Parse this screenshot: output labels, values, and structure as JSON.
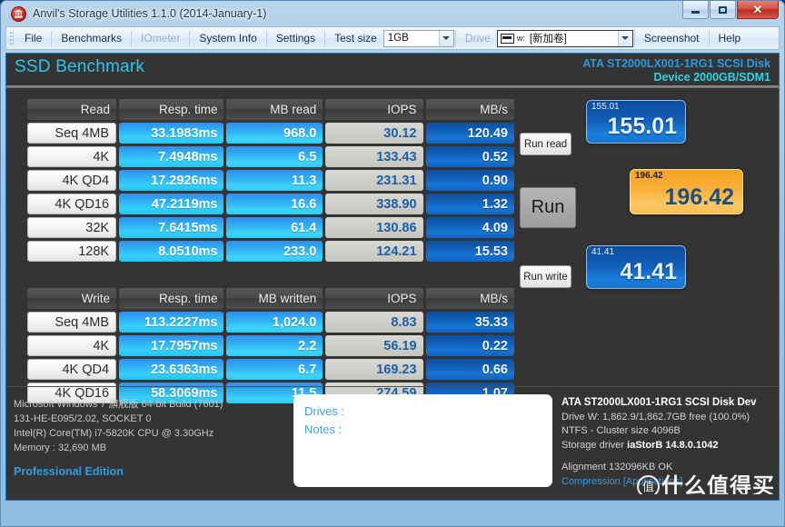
{
  "window": {
    "title": "Anvil's Storage Utilities 1.1.0 (2014-January-1)",
    "minimize_label": "Minimize",
    "maximize_label": "Maximize",
    "close_label": "Close"
  },
  "toolbar": {
    "file": "File",
    "benchmarks": "Benchmarks",
    "iometer": "IOmeter",
    "system_info": "System Info",
    "settings": "Settings",
    "test_size_label": "Test size",
    "test_size_value": "1GB",
    "drive_label": "Drive",
    "drive_prefix": "w:",
    "drive_value": "[新加卷]",
    "screenshot": "Screenshot",
    "help": "Help"
  },
  "header": {
    "section_title": "SSD Benchmark",
    "device_line1": "ATA ST2000LX001-1RG1 SCSI Disk",
    "device_line2": "Device 2000GB/SDM1"
  },
  "read_table": {
    "headers": [
      "Read",
      "Resp. time",
      "MB read",
      "IOPS",
      "MB/s"
    ],
    "rows": [
      {
        "label": "Seq 4MB",
        "resp": "33.1983ms",
        "mb": "968.0",
        "iops": "30.12",
        "mbs": "120.49"
      },
      {
        "label": "4K",
        "resp": "7.4948ms",
        "mb": "6.5",
        "iops": "133.43",
        "mbs": "0.52"
      },
      {
        "label": "4K QD4",
        "resp": "17.2926ms",
        "mb": "11.3",
        "iops": "231.31",
        "mbs": "0.90"
      },
      {
        "label": "4K QD16",
        "resp": "47.2119ms",
        "mb": "16.6",
        "iops": "338.90",
        "mbs": "1.32"
      },
      {
        "label": "32K",
        "resp": "7.6415ms",
        "mb": "61.4",
        "iops": "130.86",
        "mbs": "4.09"
      },
      {
        "label": "128K",
        "resp": "8.0510ms",
        "mb": "233.0",
        "iops": "124.21",
        "mbs": "15.53"
      }
    ]
  },
  "write_table": {
    "headers": [
      "Write",
      "Resp. time",
      "MB written",
      "IOPS",
      "MB/s"
    ],
    "rows": [
      {
        "label": "Seq 4MB",
        "resp": "113.2227ms",
        "mb": "1,024.0",
        "iops": "8.83",
        "mbs": "35.33"
      },
      {
        "label": "4K",
        "resp": "17.7957ms",
        "mb": "2.2",
        "iops": "56.19",
        "mbs": "0.22"
      },
      {
        "label": "4K QD4",
        "resp": "23.6363ms",
        "mb": "6.7",
        "iops": "169.23",
        "mbs": "0.66"
      },
      {
        "label": "4K QD16",
        "resp": "58.3069ms",
        "mb": "11.5",
        "iops": "274.59",
        "mbs": "1.07"
      }
    ]
  },
  "controls": {
    "run_read": "Run read",
    "run_all": "Run",
    "run_write": "Run write"
  },
  "scores": {
    "read_tag": "155.01",
    "read_value": "155.01",
    "total_tag": "196.42",
    "total_value": "196.42",
    "write_tag": "41.41",
    "write_value": "41.41"
  },
  "system_info": {
    "os": "Microsoft Windows 7 旗舰版  64-bit Build (7601)",
    "board": "131-HE-E095/2.02, SOCKET 0",
    "cpu": "Intel(R) Core(TM) i7-5820K CPU @ 3.30GHz",
    "memory": "Memory : 32,690 MB",
    "edition": "Professional Edition"
  },
  "notes_panel": {
    "drives_label": "Drives :",
    "notes_label": "Notes :"
  },
  "drive_info": {
    "device": "ATA ST2000LX001-1RG1 SCSI Disk Dev",
    "capacity": "Drive W: 1,862.9/1,862.7GB free (100.0%)",
    "filesystem": "NTFS - Cluster size 4096B",
    "driver_label": "Storage driver",
    "driver_value": "iaStorB 14.8.0.1042",
    "alignment": "Alignment 132096KB OK",
    "compression": "Compression",
    "compression_link": "[Applications]"
  },
  "watermark": {
    "mark": "值",
    "text": "什么值得买"
  },
  "colors": {
    "accent_cyan": "#26c6f0",
    "accent_blue": "#2f9ce0",
    "score_orange": "#f9b03a",
    "score_blue": "#1160b8"
  }
}
